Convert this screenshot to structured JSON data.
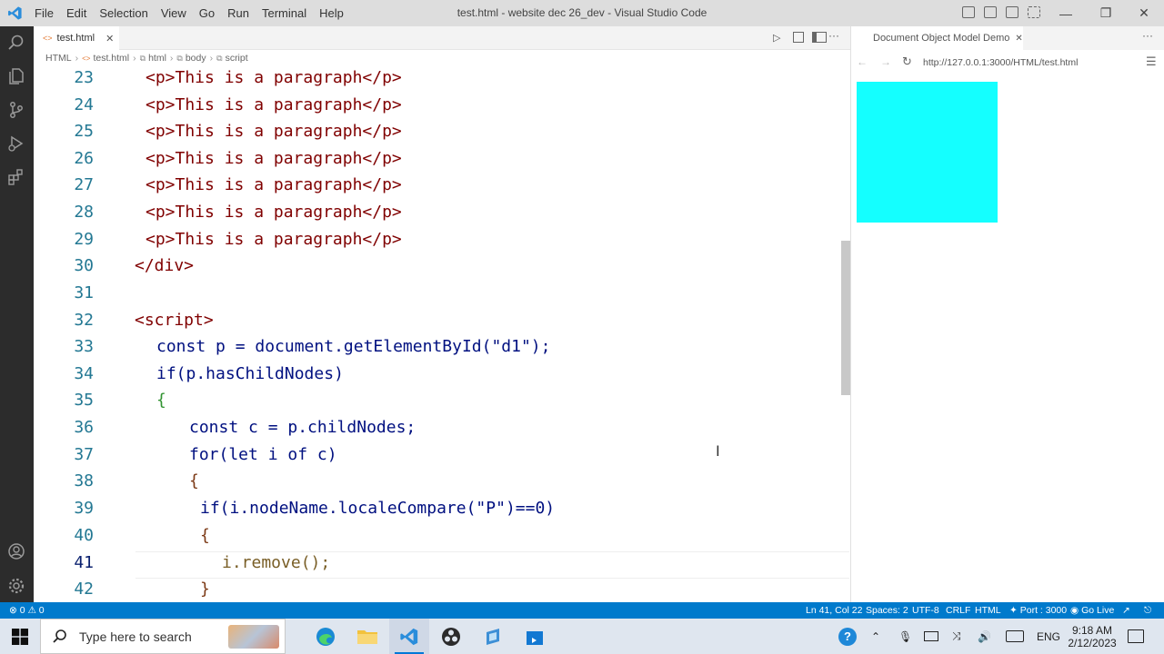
{
  "window": {
    "title": "test.html - website dec 26_dev - Visual Studio Code",
    "menu": [
      "File",
      "Edit",
      "Selection",
      "View",
      "Go",
      "Run",
      "Terminal",
      "Help"
    ]
  },
  "editor": {
    "tab_label": "test.html",
    "breadcrumb": [
      "HTML",
      "test.html",
      "html",
      "body",
      "script"
    ],
    "lines": [
      {
        "n": "23",
        "text": "<p>This is a paragraph</p>"
      },
      {
        "n": "24",
        "text": "<p>This is a paragraph</p>"
      },
      {
        "n": "25",
        "text": "<p>This is a paragraph</p>"
      },
      {
        "n": "26",
        "text": "<p>This is a paragraph</p>"
      },
      {
        "n": "27",
        "text": "<p>This is a paragraph</p>"
      },
      {
        "n": "28",
        "text": "<p>This is a paragraph</p>"
      },
      {
        "n": "29",
        "text": "<p>This is a paragraph</p>"
      },
      {
        "n": "30",
        "text": "</div>"
      },
      {
        "n": "31",
        "text": ""
      },
      {
        "n": "32",
        "text": "<script>"
      },
      {
        "n": "33",
        "text": "const p = document.getElementById(\"d1\");"
      },
      {
        "n": "34",
        "text": "if(p.hasChildNodes)"
      },
      {
        "n": "35",
        "text": "{"
      },
      {
        "n": "36",
        "text": "const c = p.childNodes;"
      },
      {
        "n": "37",
        "text": "for(let i of c)"
      },
      {
        "n": "38",
        "text": "{"
      },
      {
        "n": "39",
        "text": "if(i.nodeName.localeCompare(\"P\")==0)"
      },
      {
        "n": "40",
        "text": "{"
      },
      {
        "n": "41",
        "text": "i.remove();"
      },
      {
        "n": "42",
        "text": "}"
      }
    ],
    "active_line": "41"
  },
  "preview": {
    "tab_label": "Document Object Model Demo",
    "url": "http://127.0.0.1:3000/HTML/test.html",
    "box_color": "#14ffff"
  },
  "statusbar": {
    "problems": "0 ⚠ 0",
    "position": "Ln 41, Col 22",
    "spaces": "Spaces: 2",
    "encoding": "UTF-8",
    "eol": "CRLF",
    "language": "HTML",
    "port": "Port : 3000",
    "golive": "Go Live",
    "bg_color": "#007acc"
  },
  "taskbar": {
    "search_placeholder": "Type here to search",
    "language": "ENG",
    "time": "9:18 AM",
    "date": "2/12/2023"
  }
}
